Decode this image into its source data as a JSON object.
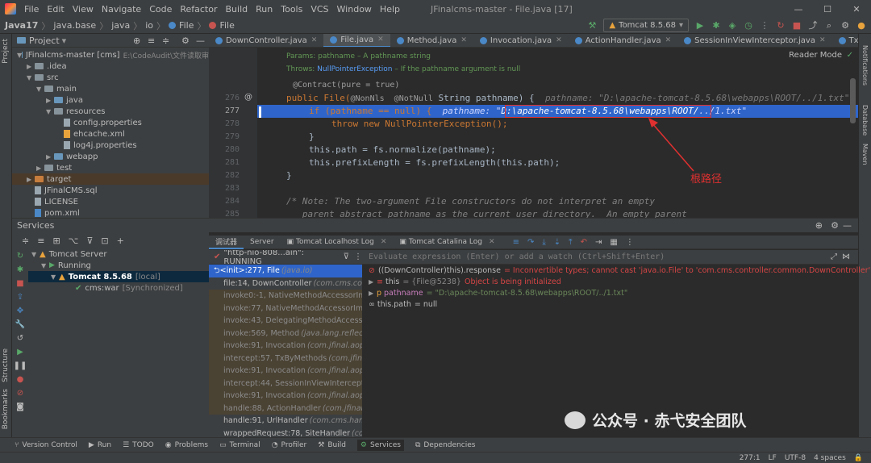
{
  "menubar": {
    "items": [
      "File",
      "Edit",
      "View",
      "Navigate",
      "Code",
      "Refactor",
      "Build",
      "Run",
      "Tools",
      "VCS",
      "Window",
      "Help"
    ],
    "window_title": "JFinalcms-master - File.java [17]"
  },
  "navbar": {
    "crumbs": [
      "Java17",
      "java.base",
      "java",
      "io",
      "File",
      "File"
    ],
    "run_config": "Tomcat 8.5.68"
  },
  "project": {
    "header": "Project",
    "rows": [
      {
        "label": "JFinalcms-master [cms]",
        "extra": "E:\\CodeAudit\\文件读取审",
        "indent": 0
      },
      {
        "label": ".idea",
        "extra": "",
        "indent": 1
      },
      {
        "label": "src",
        "extra": "",
        "indent": 1
      },
      {
        "label": "main",
        "extra": "",
        "indent": 2
      },
      {
        "label": "java",
        "extra": "",
        "indent": 3
      },
      {
        "label": "resources",
        "extra": "",
        "indent": 3
      },
      {
        "label": "config.properties",
        "extra": "",
        "indent": 4
      },
      {
        "label": "ehcache.xml",
        "extra": "",
        "indent": 4
      },
      {
        "label": "log4j.properties",
        "extra": "",
        "indent": 4
      },
      {
        "label": "webapp",
        "extra": "",
        "indent": 3
      },
      {
        "label": "test",
        "extra": "",
        "indent": 2
      },
      {
        "label": "target",
        "extra": "",
        "indent": 1
      },
      {
        "label": "JFinalCMS.sql",
        "extra": "",
        "indent": 1
      },
      {
        "label": "LICENSE",
        "extra": "",
        "indent": 1
      },
      {
        "label": "pom.xml",
        "extra": "",
        "indent": 1
      }
    ]
  },
  "editor_tabs": [
    "DownController.java",
    "File.java",
    "Method.java",
    "Invocation.java",
    "ActionHandler.java",
    "SessionInViewInterceptor.java",
    "TxByMethods.java"
  ],
  "editor": {
    "reader_mode": "Reader Mode",
    "doc_params": "Params: pathname – A pathname string",
    "doc_throws_prefix": "Throws:",
    "doc_throws_class": "NullPointerException",
    "doc_throws_rest": "– If the pathname argument is null",
    "contract": "@Contract(pure = true)",
    "line_numbers": [
      "276",
      "277",
      "278",
      "279",
      "280",
      "281",
      "282",
      "283",
      "284",
      "285"
    ],
    "l276_sig": "public File(",
    "l276_ann": "@NonNls  @NotNull",
    "l276_rest": "String pathname) {",
    "l276_hint": "pathname: \"D:\\apache-tomcat-8.5.68\\webapps\\ROOT/../1.txt\"",
    "l277_code": "if (pathname == null) {",
    "l277_hint_a": "pathname: \"",
    "l277_hint_b": "D:\\apache-tomcat-8.5.68\\webapps\\ROOT/",
    "l277_hint_c": "../1.txt\"",
    "l278": "throw new NullPointerException();",
    "l279": "}",
    "l280": "this.path = fs.normalize(pathname);",
    "l281": "this.prefixLength = fs.prefixLength(this.path);",
    "l282": "}",
    "l284": "/* Note: The two-argument File constructors do not interpret an empty",
    "l285": "   parent abstract pathname as the current user directory.  An empty parent"
  },
  "annotation": "根路径",
  "services": {
    "header": "Services",
    "tree": [
      {
        "label": "Tomcat Server",
        "extra": ""
      },
      {
        "label": "Running",
        "extra": ""
      },
      {
        "label": "Tomcat 8.5.68",
        "extra": "[local]"
      },
      {
        "label": "cms:war",
        "extra": "[Synchronized]"
      }
    ]
  },
  "debug_tabs": [
    "调试器",
    "Server",
    "Tomcat Localhost Log",
    "Tomcat Catalina Log"
  ],
  "debugger": {
    "thread": "\"http-nio-808...ain\": RUNNING",
    "eval_placeholder": "Evaluate expression (Enter) or add a watch (Ctrl+Shift+Enter)",
    "frames": [
      {
        "m": "<init>:277, File",
        "c": "(java.io)",
        "kind": "sel"
      },
      {
        "m": "file:14, DownController",
        "c": "(com.cms.contro",
        "kind": "app"
      },
      {
        "m": "invoke0:-1, NativeMethodAccessorImpl",
        "c": "",
        "kind": "lib"
      },
      {
        "m": "invoke:77, NativeMethodAccessorImpl",
        "c": "",
        "kind": "lib"
      },
      {
        "m": "invoke:43, DelegatingMethodAccessorIm",
        "c": "",
        "kind": "lib"
      },
      {
        "m": "invoke:569, Method",
        "c": "(java.lang.reflect)",
        "kind": "lib"
      },
      {
        "m": "invoke:91, Invocation",
        "c": "(com.jfinal.aop)",
        "kind": "lib"
      },
      {
        "m": "intercept:57, TxByMethods",
        "c": "(com.jfinal.pl",
        "kind": "lib"
      },
      {
        "m": "invoke:91, Invocation",
        "c": "(com.jfinal.aop)",
        "kind": "lib"
      },
      {
        "m": "intercept:44, SessionInViewInterceptor",
        "c": "",
        "kind": "lib"
      },
      {
        "m": "invoke:91, Invocation",
        "c": "(com.jfinal.aop)",
        "kind": "lib"
      },
      {
        "m": "handle:88, ActionHandler",
        "c": "(com.jfinal.co",
        "kind": "lib"
      },
      {
        "m": "handle:91, UrlHandler",
        "c": "(com.cms.handler",
        "kind": "app"
      },
      {
        "m": "wrappedRequest:78, SiteHandler",
        "c": "(com.",
        "kind": "app"
      }
    ],
    "vars": {
      "v1_expr": "((DownController)this).response",
      "v1_val": "= Inconvertible types; cannot cast 'java.io.File' to 'com.cms.controller.common.DownController'",
      "v2_name": "this",
      "v2_type": "= {File@5238}",
      "v2_val": "Object is being initialized",
      "v3_name": "pathname",
      "v3_val": "= \"D:\\apache-tomcat-8.5.68\\webapps\\ROOT/../1.txt\"",
      "v4_name": "this.path",
      "v4_val": "= null"
    }
  },
  "bottom_tabs": [
    "Version Control",
    "Run",
    "TODO",
    "Problems",
    "Terminal",
    "Profiler",
    "Build",
    "Services",
    "Dependencies"
  ],
  "status": {
    "pos": "277:1",
    "lf": "LF",
    "enc": "UTF-8",
    "indent": "4 spaces"
  },
  "strips": {
    "left": [
      "Project",
      "Structure",
      "Bookmarks"
    ],
    "right": [
      "Notifications",
      "Database",
      "Maven"
    ]
  },
  "watermark": "公众号 · 赤弋安全团队"
}
